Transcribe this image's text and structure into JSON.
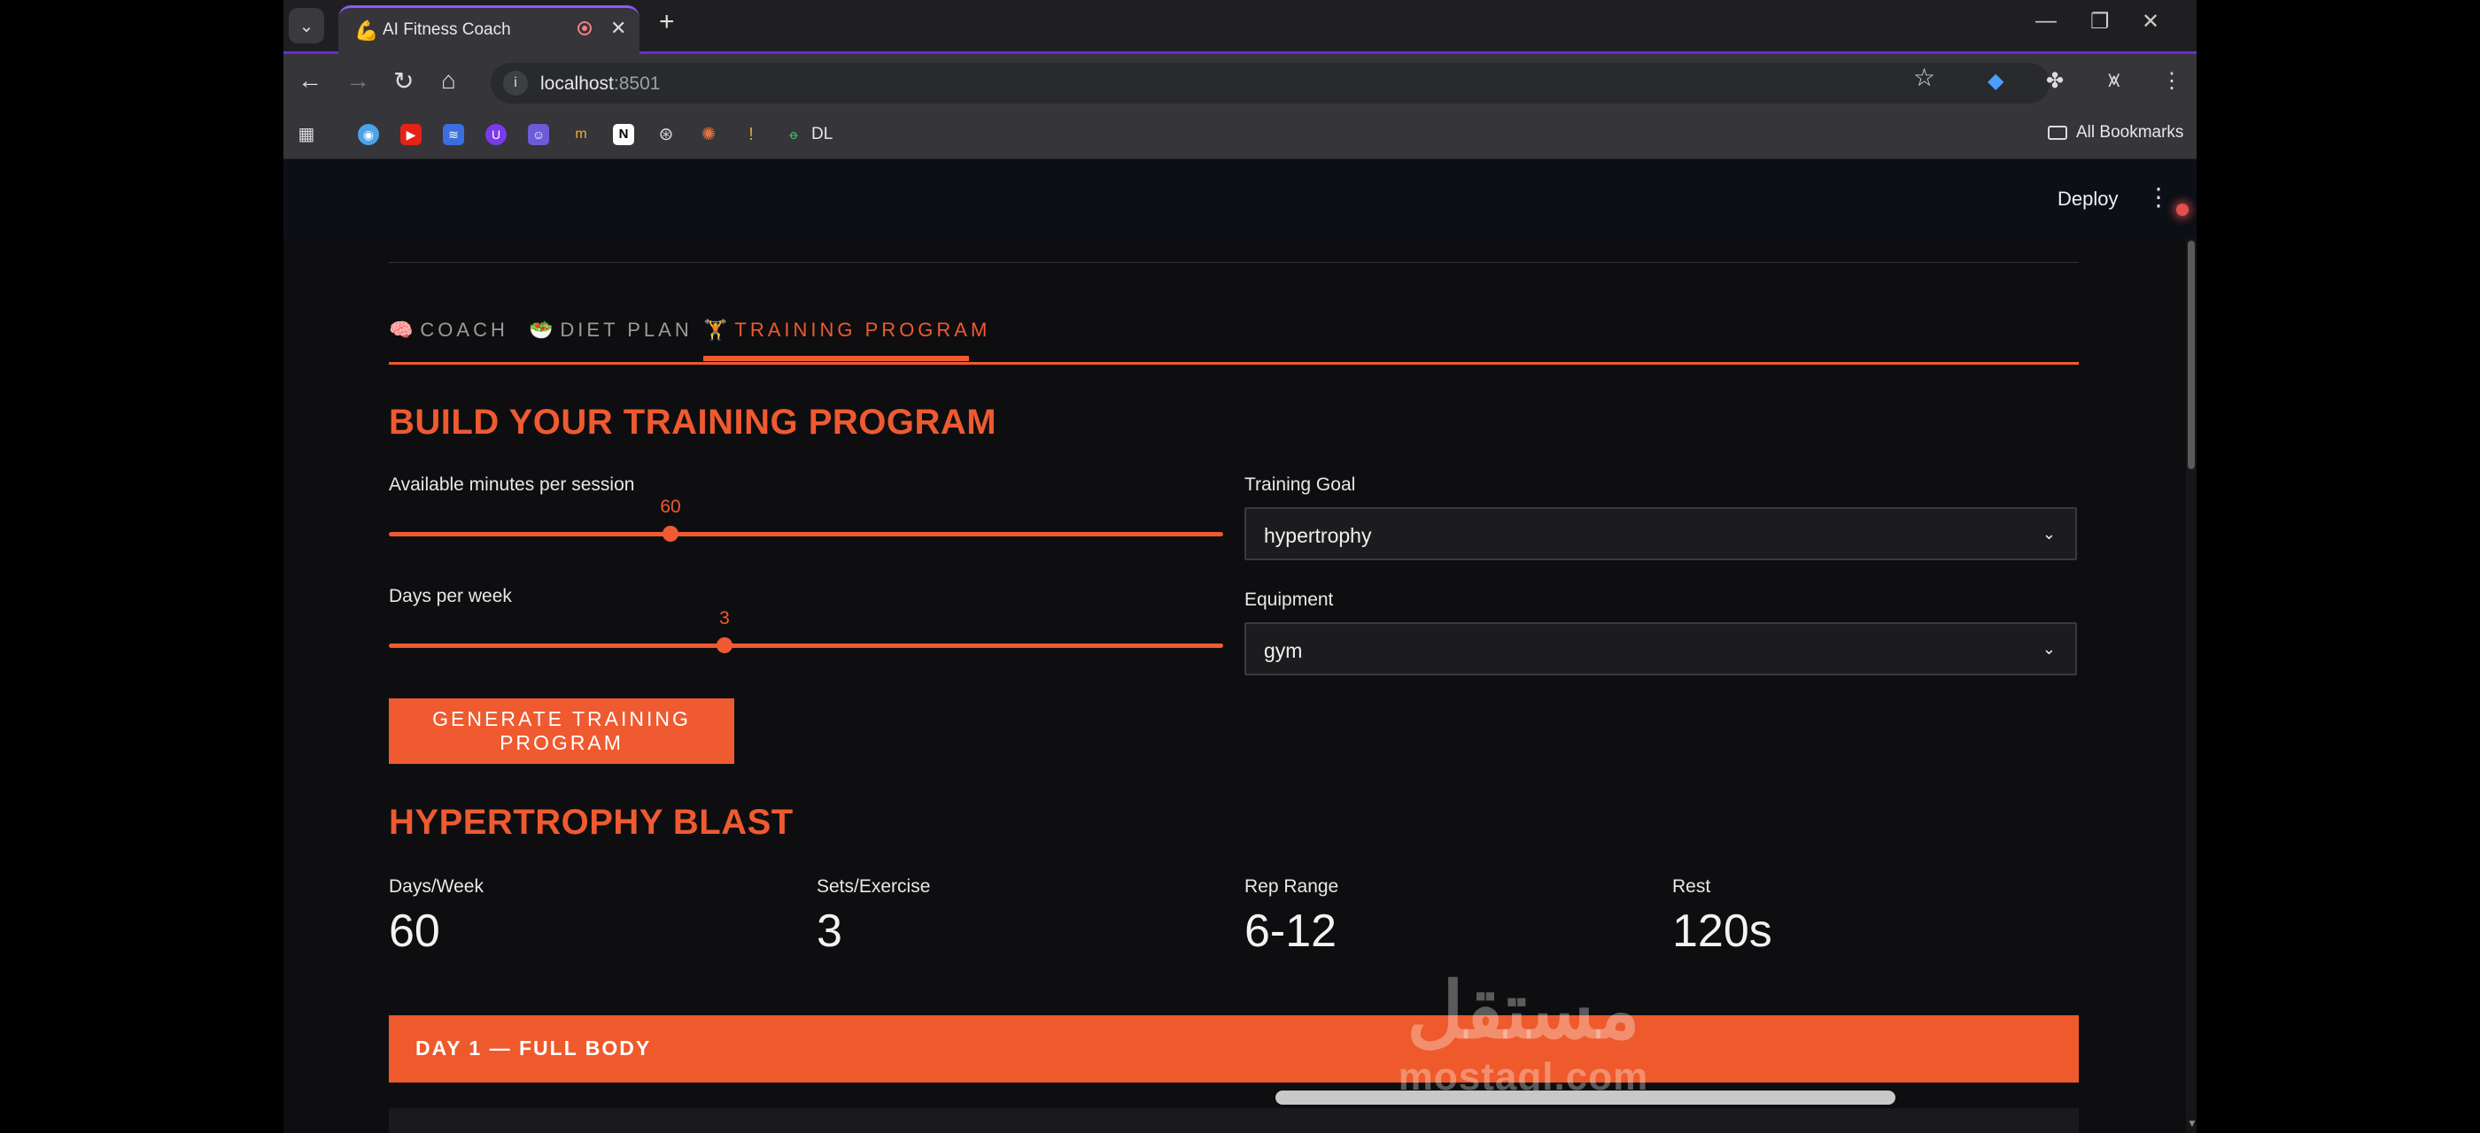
{
  "browser": {
    "tab_title": "AI Fitness Coach",
    "tab_favicon": "💪",
    "url_host": "localhost",
    "url_port": ":8501",
    "bookmarks_dl": "DL",
    "all_bookmarks": "All Bookmarks"
  },
  "app": {
    "deploy_label": "Deploy",
    "tabs": [
      {
        "icon": "🧠",
        "label": "COACH",
        "active": false
      },
      {
        "icon": "🥗",
        "label": "DIET PLAN",
        "active": false
      },
      {
        "icon": "🏋",
        "label": "TRAINING PROGRAM",
        "active": true
      }
    ],
    "section_title": "BUILD YOUR TRAINING PROGRAM",
    "minutes_slider": {
      "label": "Available minutes per session",
      "value": "60",
      "fraction": 0.338
    },
    "days_slider": {
      "label": "Days per week",
      "value": "3",
      "fraction": 0.402
    },
    "training_goal": {
      "label": "Training Goal",
      "value": "hypertrophy"
    },
    "equipment": {
      "label": "Equipment",
      "value": "gym"
    },
    "generate_button": "GENERATE TRAINING PROGRAM",
    "program_title": "HYPERTROPHY BLAST",
    "metrics": [
      {
        "label": "Days/Week",
        "value": "60"
      },
      {
        "label": "Sets/Exercise",
        "value": "3"
      },
      {
        "label": "Rep Range",
        "value": "6-12"
      },
      {
        "label": "Rest",
        "value": "120s"
      }
    ],
    "day_header": "DAY 1 — FULL BODY"
  },
  "watermark": {
    "arabic": "مستقل",
    "latin": "mostaql.com"
  },
  "colors": {
    "accent": "#ef5a30",
    "tab_highlight": "#8b5cf6",
    "background": "#0e0e10"
  }
}
